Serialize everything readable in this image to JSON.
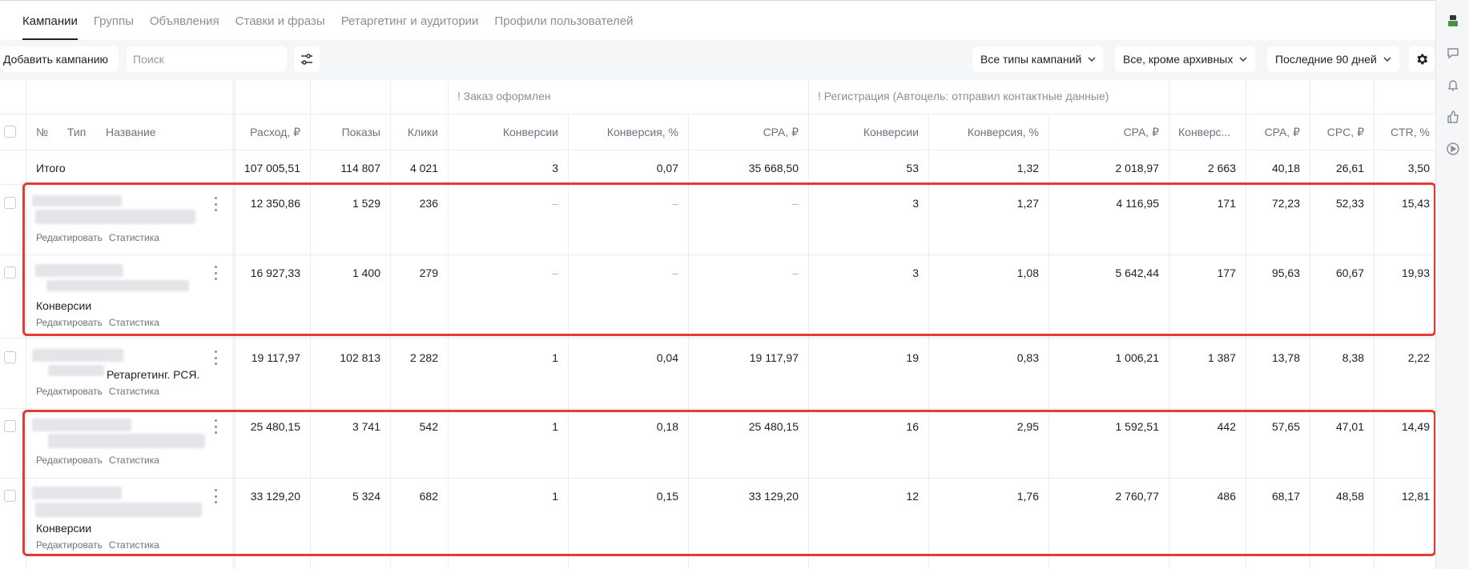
{
  "nav": {
    "tabs": [
      "Кампании",
      "Группы",
      "Объявления",
      "Ставки и фразы",
      "Ретаргетинг и аудитории",
      "Профили пользователей"
    ]
  },
  "toolbar": {
    "add_campaign": "Добавить кампанию",
    "search_placeholder": "Поиск",
    "filter_campaign_types": "Все типы кампаний",
    "filter_status": "Все, кроме архивных",
    "filter_period": "Последние 90 дней"
  },
  "table": {
    "group_headers": {
      "order": "! Заказ оформлен",
      "registration": "! Регистрация (Автоцель: отправил контактные данные)"
    },
    "columns": {
      "num": "№",
      "type": "Тип",
      "name": "Название",
      "spend": "Расход, ₽",
      "impressions": "Показы",
      "clicks": "Клики",
      "conv1": "Конверсии",
      "convrate1": "Конверсия, %",
      "cpa1": "CPA, ₽",
      "conv2": "Конверсии",
      "convrate2": "Конверсия, %",
      "cpa2": "CPA, ₽",
      "conv3": "Конверс...",
      "cpa3": "CPA, ₽",
      "cpc": "CPC, ₽",
      "ctr": "CTR, %"
    },
    "total": {
      "label": "Итого",
      "values": [
        "107 005,51",
        "114 807",
        "4 021",
        "3",
        "0,07",
        "35 668,50",
        "53",
        "1,32",
        "2 018,97",
        "2 663",
        "40,18",
        "26,61",
        "3,50"
      ]
    },
    "row_links": {
      "edit": "Редактировать",
      "stats": "Статистика"
    },
    "rows": [
      {
        "name_suffix": "",
        "values": [
          "12 350,86",
          "1 529",
          "236",
          "–",
          "–",
          "–",
          "3",
          "1,27",
          "4 116,95",
          "171",
          "72,23",
          "52,33",
          "15,43"
        ]
      },
      {
        "name_suffix": "Конверсии",
        "values": [
          "16 927,33",
          "1 400",
          "279",
          "–",
          "–",
          "–",
          "3",
          "1,08",
          "5 642,44",
          "177",
          "95,63",
          "60,67",
          "19,93"
        ]
      },
      {
        "name_suffix": "Ретаргетинг. РСЯ.",
        "values": [
          "19 117,97",
          "102 813",
          "2 282",
          "1",
          "0,04",
          "19 117,97",
          "19",
          "0,83",
          "1 006,21",
          "1 387",
          "13,78",
          "8,38",
          "2,22"
        ]
      },
      {
        "name_suffix": "",
        "values": [
          "25 480,15",
          "3 741",
          "542",
          "1",
          "0,18",
          "25 480,15",
          "16",
          "2,95",
          "1 592,51",
          "442",
          "57,65",
          "47,01",
          "14,49"
        ]
      },
      {
        "name_suffix": "Конверсии",
        "values": [
          "33 129,20",
          "5 324",
          "682",
          "1",
          "0,15",
          "33 129,20",
          "12",
          "1,76",
          "2 760,77",
          "486",
          "68,17",
          "48,58",
          "12,81"
        ]
      }
    ]
  },
  "icons": {
    "right_panel": [
      "robot-icon",
      "chat-icon",
      "bell-icon",
      "thumbs-up-icon",
      "play-icon"
    ]
  },
  "colors": {
    "highlight": "#e53935",
    "panel_bg": "#f5f6f8"
  }
}
